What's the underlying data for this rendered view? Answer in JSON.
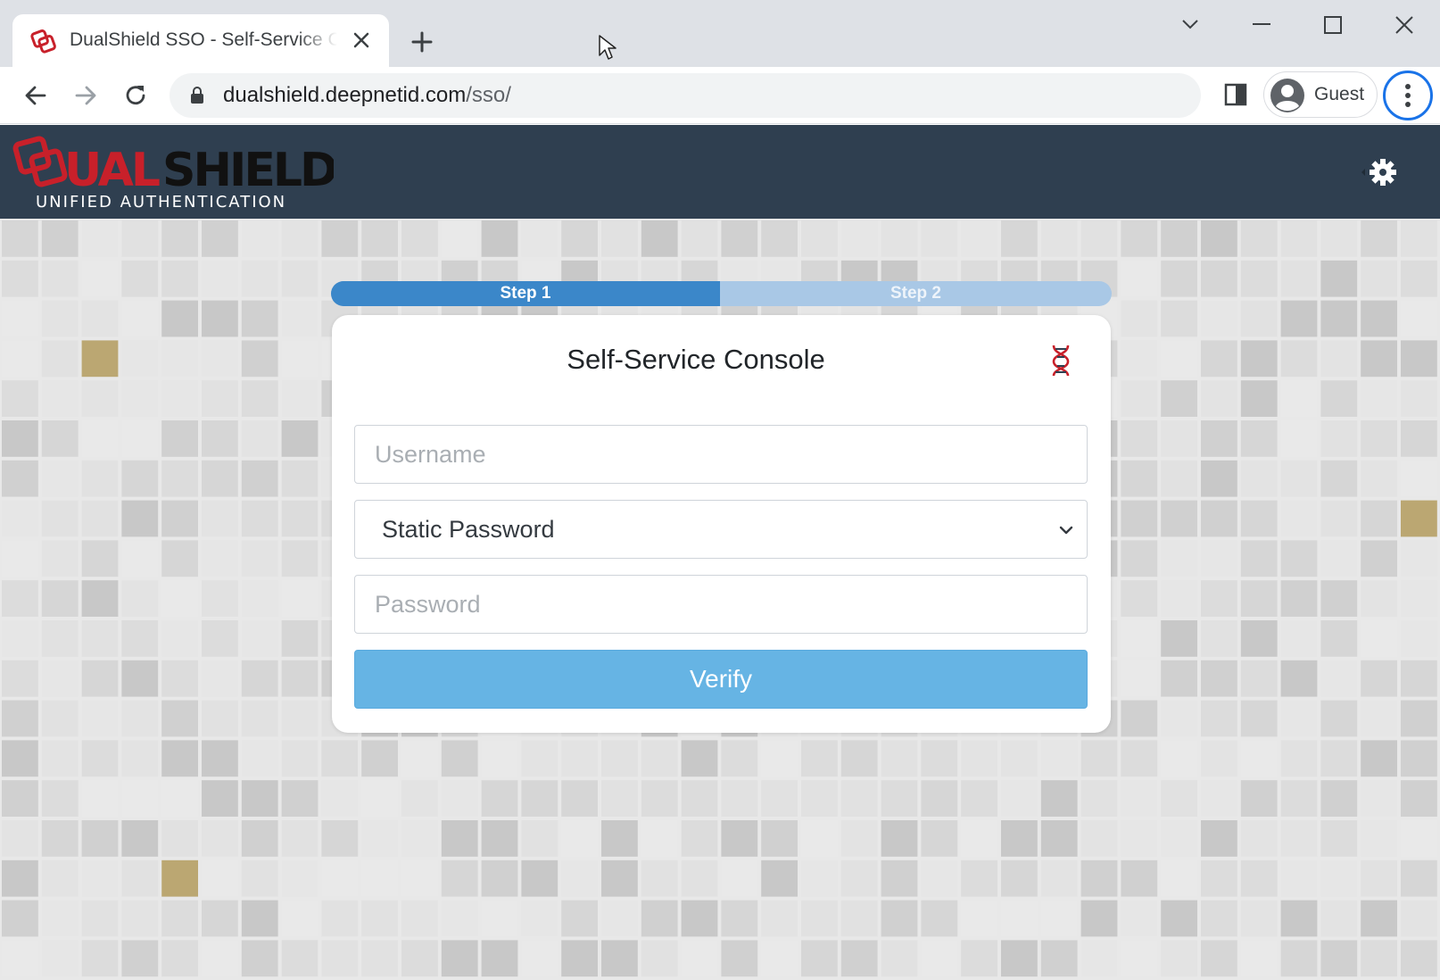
{
  "browser": {
    "tab_title": "DualShield SSO - Self-Service Console",
    "url_host": "dualshield.deepnetid.com",
    "url_path": "/sso/",
    "profile_label": "Guest"
  },
  "site": {
    "logo_text_main": "DUALSHIELD",
    "logo_text_sub": "UNIFIED AUTHENTICATION",
    "brand_red": "#c8202a",
    "header_bg": "#2f3f50"
  },
  "stepper": {
    "steps": [
      {
        "label": "Step 1",
        "active": true
      },
      {
        "label": "Step 2",
        "active": false
      }
    ]
  },
  "login": {
    "title": "Self-Service Console",
    "username_placeholder": "Username",
    "method_selected": "Static Password",
    "password_placeholder": "Password",
    "verify_label": "Verify"
  },
  "icons": {
    "settings": "gear-icon",
    "identity": "dna-icon"
  }
}
